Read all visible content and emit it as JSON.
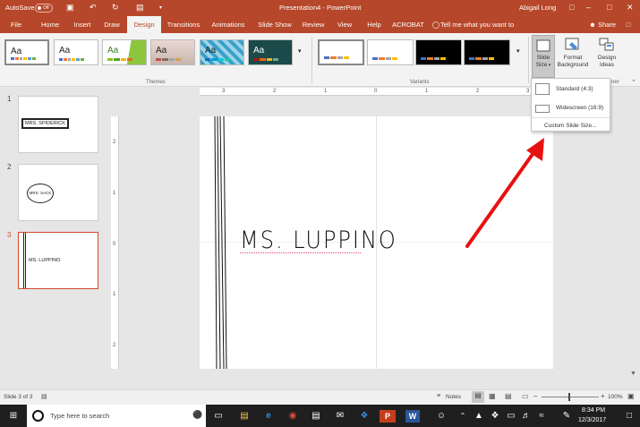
{
  "window": {
    "autosave_label": "AutoSave",
    "autosave_state": "Off",
    "title": "Presentation4 - PowerPoint",
    "user": "Abigail Long"
  },
  "tabs": [
    {
      "label": "File"
    },
    {
      "label": "Home"
    },
    {
      "label": "Insert"
    },
    {
      "label": "Draw"
    },
    {
      "label": "Design"
    },
    {
      "label": "Transitions"
    },
    {
      "label": "Animations"
    },
    {
      "label": "Slide Show"
    },
    {
      "label": "Review"
    },
    {
      "label": "View"
    },
    {
      "label": "Help"
    },
    {
      "label": "ACROBAT"
    }
  ],
  "tell_me": "Tell me what you want to do",
  "share_label": "Share",
  "ribbon": {
    "themes_label": "Themes",
    "variants_label": "Variants",
    "theme_text": "Aa",
    "slide_size": "Slide Size",
    "format_background": "Format Background",
    "design_ideas": "Design Ideas",
    "format_background_l1": "Format",
    "format_background_l2": "Background",
    "design_ideas_l1": "Design",
    "design_ideas_l2": "Ideas",
    "slide_size_l1": "Slide",
    "slide_size_l2": "Size",
    "cut_label": "ner"
  },
  "slide_size_menu": {
    "standard": "Standard (4:3)",
    "widescreen": "Widescreen (16:9)",
    "custom": "Custom Slide Size..."
  },
  "slides": [
    {
      "number": "1",
      "text": "MRS. SPIDERICK"
    },
    {
      "number": "2",
      "text": "MRS. SACK"
    },
    {
      "number": "3",
      "text": "MS. LUPPINO"
    }
  ],
  "slide_title": "MS. LUPPINO",
  "ruler": {
    "h": [
      "3",
      "2",
      "1",
      "0",
      "1",
      "2",
      "3"
    ],
    "v": [
      "2",
      "1",
      "0",
      "1",
      "2"
    ]
  },
  "status": {
    "slide_info": "Slide 3 of 3",
    "notes": "Notes",
    "zoom": "100%"
  },
  "taskbar": {
    "search_placeholder": "Type here to search",
    "time": "8:34 PM",
    "date": "12/3/2017"
  },
  "colors": {
    "accent": "#b7472a",
    "arrow": "#e81010"
  }
}
